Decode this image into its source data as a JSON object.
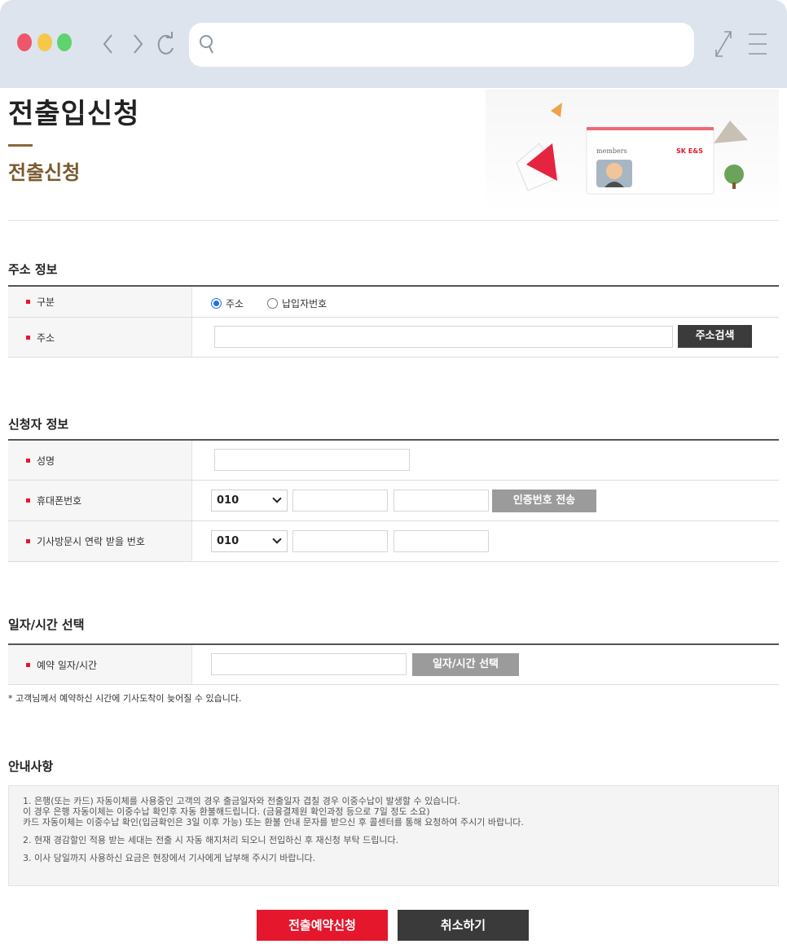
{
  "page": {
    "title": "전출입신청",
    "subtitle": "전출신청",
    "hero": {
      "card_label": "members",
      "brand": "SK E&S"
    }
  },
  "address_section": {
    "title": "주소 정보",
    "type_label": "구분",
    "type_options": [
      {
        "label": "주소",
        "selected": true
      },
      {
        "label": "납입자번호",
        "selected": false
      }
    ],
    "address_label": "주소",
    "address_value": "",
    "search_button": "주소검색"
  },
  "applicant_section": {
    "title": "신청자 정보",
    "name_label": "성명",
    "name_value": "",
    "mobile_label": "휴대폰번호",
    "mobile_prefix": "010",
    "mobile_mid": "",
    "mobile_last": "",
    "send_code_button": "인증번호 전송",
    "visit_label": "기사방문시 연락 받을 번호",
    "visit_prefix": "010",
    "visit_mid": "",
    "visit_last": ""
  },
  "schedule_section": {
    "title": "일자/시간 선택",
    "reserve_label": "예약 일자/시간",
    "reserve_value": "",
    "pick_button": "일자/시간 선택",
    "note": "* 고객님께서 예약하신 시간에 기사도착이 늦어질 수 있습니다."
  },
  "notice_section": {
    "title": "안내사항",
    "item1_line1": "1. 은행(또는 카드) 자동이체를 사용중인 고객의 경우 출금일자와 전출일자 겹칠 경우 이중수납이 발생할 수 있습니다.",
    "item1_line2": "이 경우 은행 자동이체는 이중수납 확인후 자동 환불해드립니다. (금융결제원 확인과정 등으로 7일 정도 소요)",
    "item1_line3": "카드 자동이체는 이중수납 확인(입금확인은 3일 이후 가능) 또는 환불 안내 문자를 받으신 후 콜센터를 통해 요청하여 주시기 바랍니다.",
    "item2": "2. 현재 경감할인 적용 받는 세대는 전출 시 자동 해지처리 되오니 전입하신 후 재신청 부탁 드립니다.",
    "item3": "3. 이사 당일까지 사용하신 요금은 현장에서 기사에게 납부해 주시기 바랍니다."
  },
  "actions": {
    "submit": "전출예약신청",
    "cancel": "취소하기"
  },
  "colors": {
    "accent_red": "#e5172d",
    "brown": "#7a5a2e",
    "browser_chrome": "#dde4ee",
    "dark_button": "#3b3b3b"
  },
  "icons": [
    "back-icon",
    "forward-icon",
    "reload-icon",
    "search-icon",
    "expand-icon",
    "menu-icon"
  ]
}
